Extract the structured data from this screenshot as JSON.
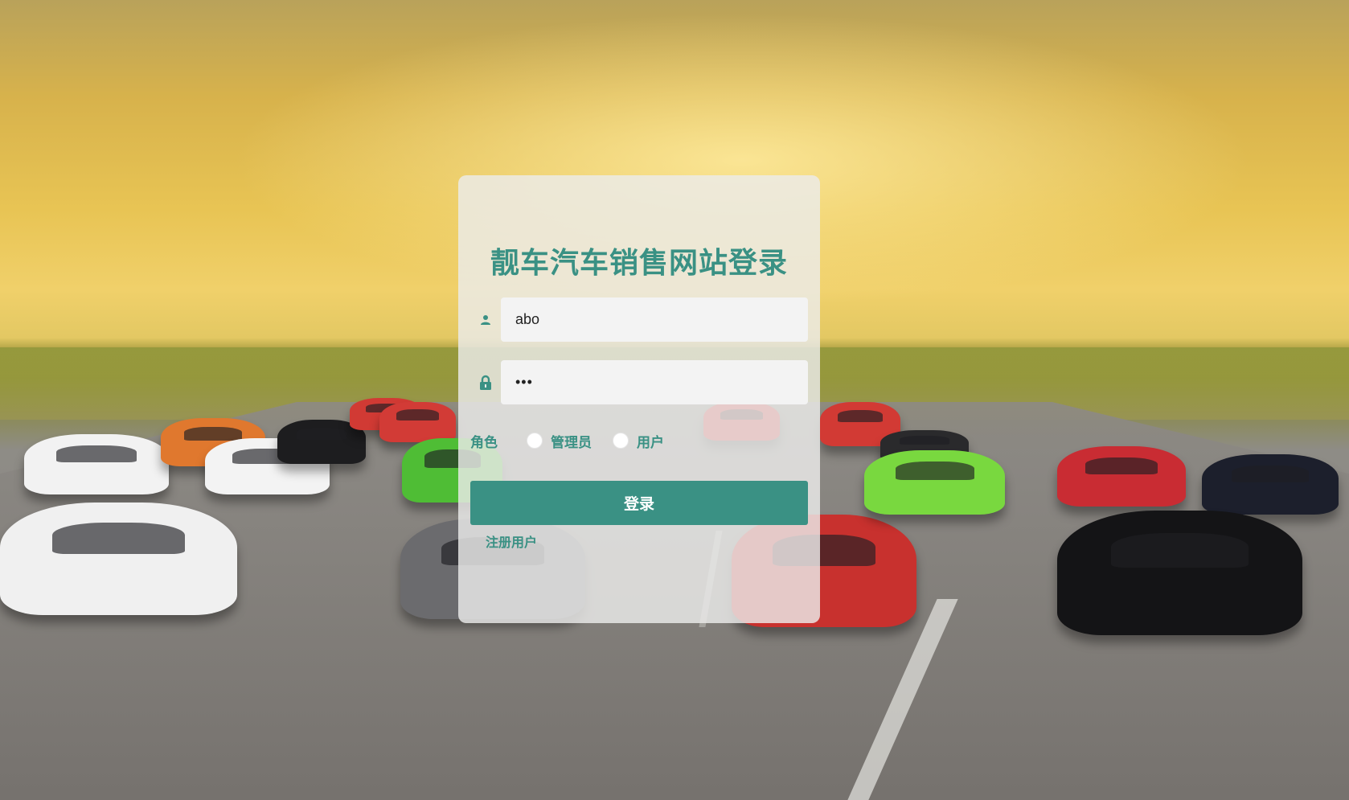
{
  "page": {
    "title": "靓车汽车销售网站登录"
  },
  "form": {
    "username_value": "abo",
    "password_value": "•••",
    "role_label": "角色",
    "role_options": [
      "管理员",
      "用户"
    ],
    "login_label": "登录",
    "register_label": "注册用户"
  },
  "colors": {
    "accent": "#3a9184"
  },
  "icons": {
    "username": "user-icon",
    "password": "lock-icon"
  }
}
